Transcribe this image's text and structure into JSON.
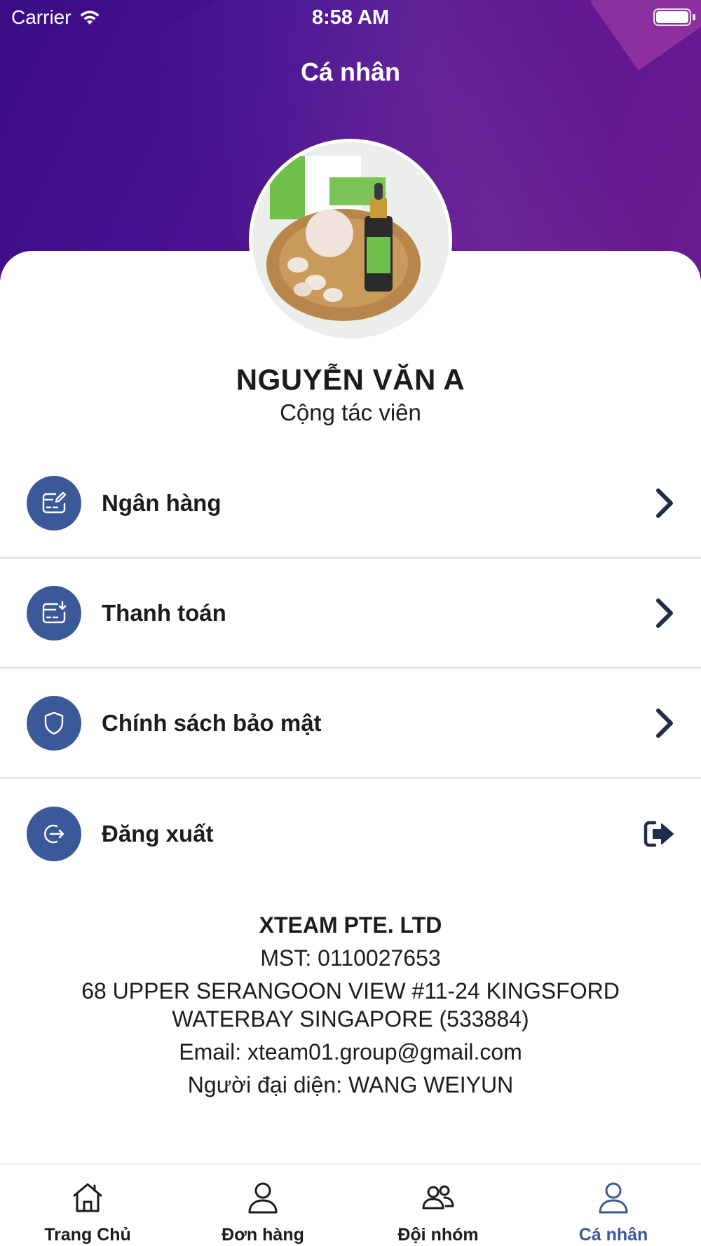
{
  "status_bar": {
    "carrier": "Carrier",
    "time": "8:58 AM"
  },
  "header": {
    "title": "Cá nhân"
  },
  "profile": {
    "name": "NGUYỄN VĂN A",
    "role": "Cộng tác viên",
    "avatar_icon": "product-photo"
  },
  "menu": {
    "items": [
      {
        "label": "Ngân hàng",
        "icon": "bank-card-edit-icon"
      },
      {
        "label": "Thanh toán",
        "icon": "payment-card-icon"
      },
      {
        "label": "Chính sách bảo mật",
        "icon": "shield-icon"
      },
      {
        "label": "Đăng xuất",
        "icon": "logout-icon"
      }
    ]
  },
  "company": {
    "name": "XTEAM PTE. LTD",
    "tax_id": "MST: 0110027653",
    "address_line1": "68 UPPER SERANGOON VIEW #11-24 KINGSFORD",
    "address_line2": "WATERBAY SINGAPORE (533884)",
    "email": "Email: xteam01.group@gmail.com",
    "representative": "Người đại diện: WANG WEIYUN"
  },
  "tabbar": {
    "tabs": [
      {
        "label": "Trang Chủ",
        "icon": "home-icon"
      },
      {
        "label": "Đơn hàng",
        "icon": "person-icon"
      },
      {
        "label": "Đội nhóm",
        "icon": "group-icon"
      },
      {
        "label": "Cá nhân",
        "icon": "person-icon",
        "active": true
      }
    ]
  },
  "colors": {
    "header_gradient_start": "#3a0c86",
    "header_gradient_end": "#6b1a90",
    "accent": "#3b5998",
    "text": "#1c1c1e"
  }
}
